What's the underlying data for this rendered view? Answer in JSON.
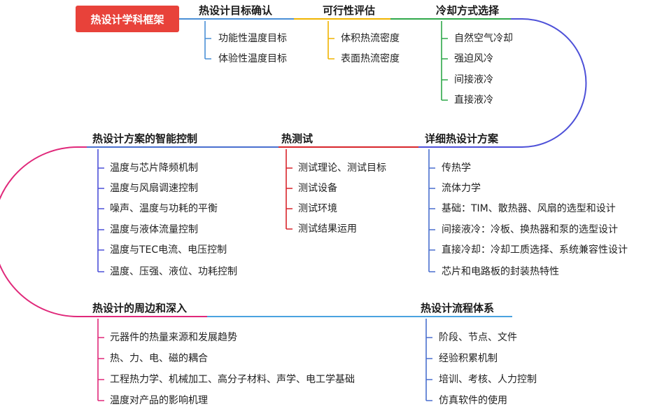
{
  "root": "热设计学科框架",
  "colors": {
    "root_bg": "#e8423a",
    "b1": "#4a8fd6",
    "b2": "#f0b400",
    "b3": "#2fa84a",
    "b4": "#4d50d8",
    "b5": "#d8252b",
    "b6": "#4a6fcf",
    "b7": "#e0287a",
    "b8": "#4aa3e0"
  },
  "branches": [
    {
      "title": "热设计目标确认",
      "items": [
        "功能性温度目标",
        "体验性温度目标"
      ]
    },
    {
      "title": "可行性评估",
      "items": [
        "体积热流密度",
        "表面热流密度"
      ]
    },
    {
      "title": "冷却方式选择",
      "items": [
        "自然空气冷却",
        "强迫风冷",
        "间接液冷",
        "直接液冷"
      ]
    },
    {
      "title": "详细热设计方案",
      "items": [
        "传热学",
        "流体力学",
        "基础：TIM、散热器、风扇的选型和设计",
        "间接液冷：冷板、换热器和泵的选型设计",
        "直接冷却：冷却工质选择、系统兼容性设计",
        "芯片和电路板的封装热特性"
      ]
    },
    {
      "title": "热测试",
      "items": [
        "测试理论、测试目标",
        "测试设备",
        "测试环境",
        "测试结果运用"
      ]
    },
    {
      "title": "热设计方案的智能控制",
      "items": [
        "温度与芯片降频机制",
        "温度与风扇调速控制",
        "噪声、温度与功耗的平衡",
        "温度与液体流量控制",
        "温度与TEC电流、电压控制",
        "温度、压强、液位、功耗控制"
      ]
    },
    {
      "title": "热设计的周边和深入",
      "items": [
        "元器件的热量来源和发展趋势",
        "热、力、电、磁的耦合",
        "工程热力学、机械加工、高分子材料、声学、电工学基础",
        "温度对产品的影响机理"
      ]
    },
    {
      "title": "热设计流程体系",
      "items": [
        "阶段、节点、文件",
        "经验积累机制",
        "培训、考核、人力控制",
        "仿真软件的使用"
      ]
    }
  ]
}
